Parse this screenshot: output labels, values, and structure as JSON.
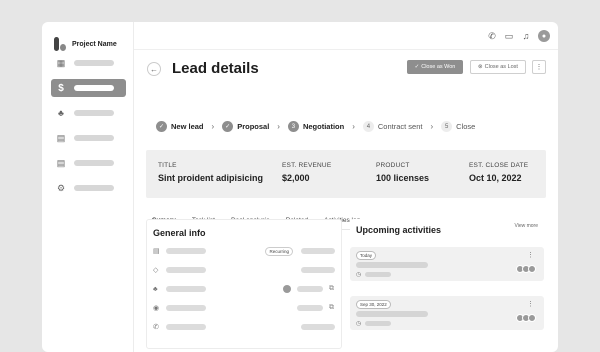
{
  "app": {
    "name": "Project Name"
  },
  "colors": {
    "accent": "#8e8e8e",
    "summary_bg": "#efefef"
  },
  "page": {
    "title": "Lead details",
    "close_won": "Close as Won",
    "close_lost": "Close as Lost"
  },
  "stages": [
    {
      "label": "New lead",
      "state": "done",
      "marker": "✓"
    },
    {
      "label": "Proposal",
      "state": "done",
      "marker": "✓"
    },
    {
      "label": "Negotiation",
      "state": "current",
      "marker": "3"
    },
    {
      "label": "Contract sent",
      "state": "todo",
      "marker": "4"
    },
    {
      "label": "Close",
      "state": "todo",
      "marker": "5"
    }
  ],
  "summary": [
    {
      "label": "TITLE",
      "value": "Sint proident adipisicing"
    },
    {
      "label": "EST. REVENUE",
      "value": "$2,000"
    },
    {
      "label": "PRODUCT",
      "value": "100 licenses"
    },
    {
      "label": "EST. CLOSE DATE",
      "value": "Oct 10, 2022"
    }
  ],
  "tabs": [
    "Sumary",
    "Task list",
    "Deal analysis",
    "Related",
    "Activities log"
  ],
  "general": {
    "title": "General info",
    "recurring_tag": "Recurring"
  },
  "activities": {
    "title": "Upcoming activities",
    "view_more": "View more",
    "dates": [
      "Today",
      "Sep 30, 2022"
    ]
  }
}
